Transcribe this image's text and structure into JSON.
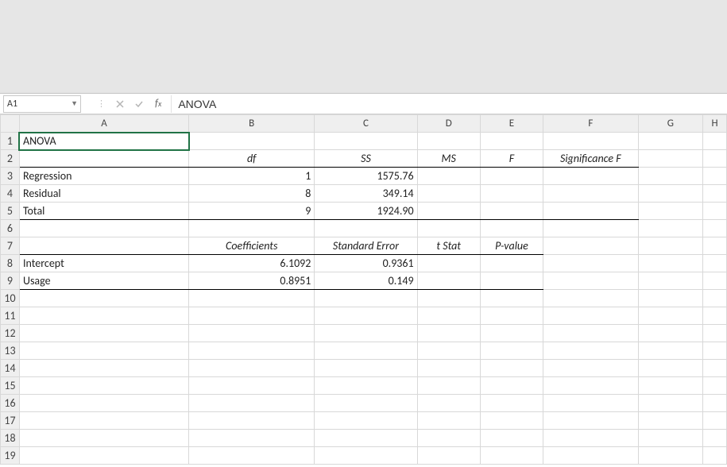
{
  "namebox": {
    "cellref": "A1"
  },
  "fx": {
    "value": "ANOVA"
  },
  "columns": [
    "A",
    "B",
    "C",
    "D",
    "E",
    "F",
    "G",
    "H"
  ],
  "rownums": [
    "1",
    "2",
    "3",
    "4",
    "5",
    "6",
    "7",
    "8",
    "9",
    "10",
    "11",
    "12",
    "13",
    "14",
    "15",
    "16",
    "17",
    "18",
    "19"
  ],
  "cells": {
    "A1": "ANOVA",
    "B2": "df",
    "C2": "SS",
    "D2": "MS",
    "E2": "F",
    "F2": "Significance F",
    "A3": "Regression",
    "B3": "1",
    "C3": "1575.76",
    "A4": "Residual",
    "B4": "8",
    "C4": "349.14",
    "A5": "Total",
    "B5": "9",
    "C5": "1924.90",
    "B7": "Coefficients",
    "C7": "Standard Error",
    "D7": "t Stat",
    "E7": "P-value",
    "A8": "Intercept",
    "B8": "6.1092",
    "C8": "0.9361",
    "A9": "Usage",
    "B9": "0.8951",
    "C9": "0.149"
  }
}
